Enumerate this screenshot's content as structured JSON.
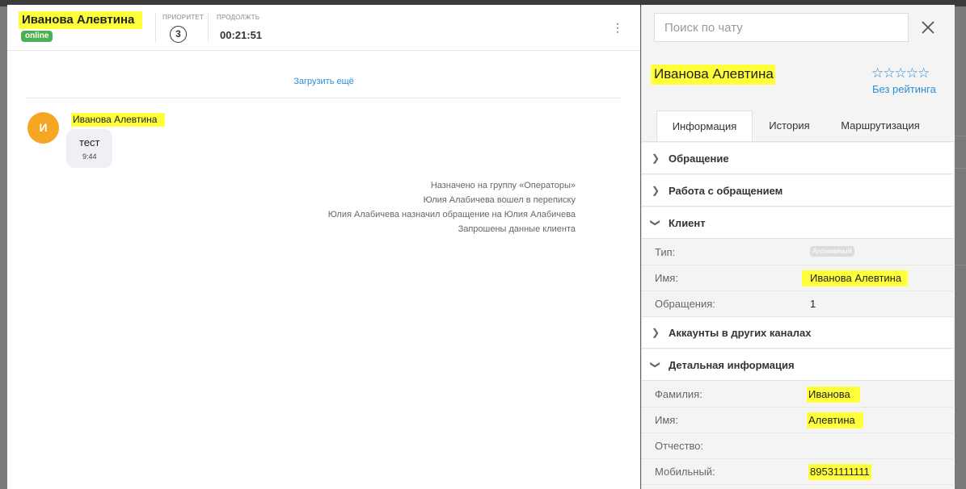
{
  "chat": {
    "client_name": "Иванова Алевтина",
    "status": "online",
    "priority_label": "Приоритет",
    "priority_value": "3",
    "duration_label": "Продолжть",
    "duration_value": "00:21:51",
    "load_more": "Загрузить ещё",
    "message": {
      "avatar_letter": "И",
      "author": "Иванова Алевтина",
      "text": "тест",
      "time": "9:44"
    },
    "system_events": [
      "Назначено на группу «Операторы»",
      "Юлия Алабичева вошел в переписку",
      "Юлия Алабичева назначил обращение на Юлия Алабичева",
      "Запрошены данные клиента"
    ]
  },
  "info": {
    "search_placeholder": "Поиск по чату",
    "client_name": "Иванова Алевтина",
    "rating_stars": "☆☆☆☆☆",
    "no_rating": "Без рейтинга",
    "tabs": [
      "Информация",
      "История",
      "Маршрутизация"
    ],
    "sections": {
      "appeal": "Обращение",
      "work": "Работа с обращением",
      "client": "Клиент",
      "accounts": "Аккаунты в других каналах",
      "details": "Детальная информация"
    },
    "client_fields": {
      "type_label": "Тип:",
      "type_value": "Анонимный",
      "name_label": "Имя:",
      "name_value": "Иванова Алевтина",
      "appeals_label": "Обращения:",
      "appeals_value": "1"
    },
    "detail_fields": {
      "surname_label": "Фамилия:",
      "surname_value": "Иванова",
      "firstname_label": "Имя:",
      "firstname_value": "Алевтина",
      "patronymic_label": "Отчество:",
      "mobile_label": "Мобильный:",
      "mobile_value": "89531111111"
    }
  },
  "colors": {
    "accent": "#2d8ed6",
    "online": "#4caf50",
    "highlight": "#ffff3a",
    "avatar": "#f5a623"
  }
}
